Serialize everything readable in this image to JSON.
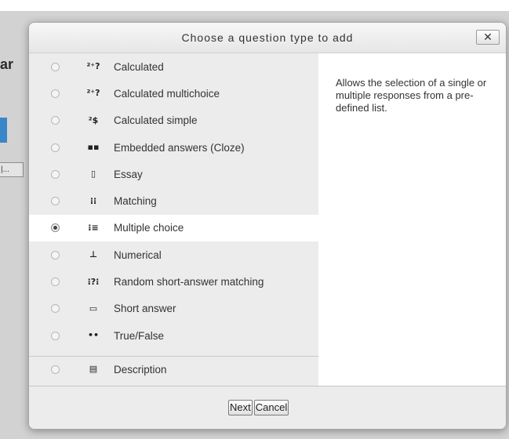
{
  "background": {
    "fragment_text": "ar",
    "button_fragment": "|..."
  },
  "dialog": {
    "title": "Choose a question type to add",
    "close_label": "✕",
    "description": "Allows the selection of a single or multiple responses from a pre-defined list.",
    "options": [
      {
        "label": "Calculated",
        "icon": "calculated-icon",
        "glyph": "²⁺?",
        "selected": false
      },
      {
        "label": "Calculated multichoice",
        "icon": "calculated-multichoice-icon",
        "glyph": "²⁺?",
        "selected": false
      },
      {
        "label": "Calculated simple",
        "icon": "calculated-simple-icon",
        "glyph": "²$",
        "selected": false
      },
      {
        "label": "Embedded answers (Cloze)",
        "icon": "cloze-icon",
        "glyph": "▪▪",
        "selected": false
      },
      {
        "label": "Essay",
        "icon": "essay-icon",
        "glyph": "▯",
        "selected": false
      },
      {
        "label": "Matching",
        "icon": "matching-icon",
        "glyph": "⁝⁝",
        "selected": false
      },
      {
        "label": "Multiple choice",
        "icon": "multiple-choice-icon",
        "glyph": "⁝≡",
        "selected": true
      },
      {
        "label": "Numerical",
        "icon": "numerical-icon",
        "glyph": "⊥",
        "selected": false
      },
      {
        "label": "Random short-answer matching",
        "icon": "random-short-answer-icon",
        "glyph": "⁝?⁝",
        "selected": false
      },
      {
        "label": "Short answer",
        "icon": "short-answer-icon",
        "glyph": "▭",
        "selected": false
      },
      {
        "label": "True/False",
        "icon": "true-false-icon",
        "glyph": "••",
        "selected": false
      },
      {
        "label": "Description",
        "icon": "description-icon",
        "glyph": "▤",
        "selected": false
      }
    ],
    "footer": {
      "next_label": "Next",
      "cancel_label": "Cancel"
    }
  },
  "colors": {
    "overlay": "#d2d2d2",
    "list_bg": "#ececec",
    "selected_bg": "#ffffff",
    "accent_blue": "#3a87c8"
  }
}
